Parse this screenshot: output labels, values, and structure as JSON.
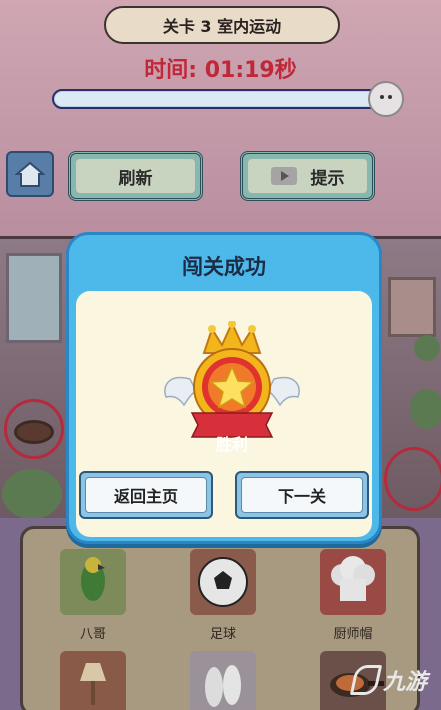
{
  "header": {
    "level_label": "关卡 3 室内运动",
    "timer": "时间: 01:19秒",
    "progress": 0.95
  },
  "toolbar": {
    "refresh_label": "刷新",
    "hint_label": "提示"
  },
  "items": [
    {
      "label": "八哥"
    },
    {
      "label": "足球"
    },
    {
      "label": "厨师帽"
    },
    {
      "label": ""
    },
    {
      "label": ""
    },
    {
      "label": ""
    }
  ],
  "modal": {
    "title": "闯关成功",
    "badge_text": "胜利",
    "home_label": "返回主页",
    "next_label": "下一关"
  },
  "watermark": {
    "text": "九游"
  },
  "colors": {
    "modal_blue": "#4cb9ea",
    "timer_red": "#c0283a",
    "badge_red": "#d8303a",
    "crown_gold": "#f2b51c"
  }
}
